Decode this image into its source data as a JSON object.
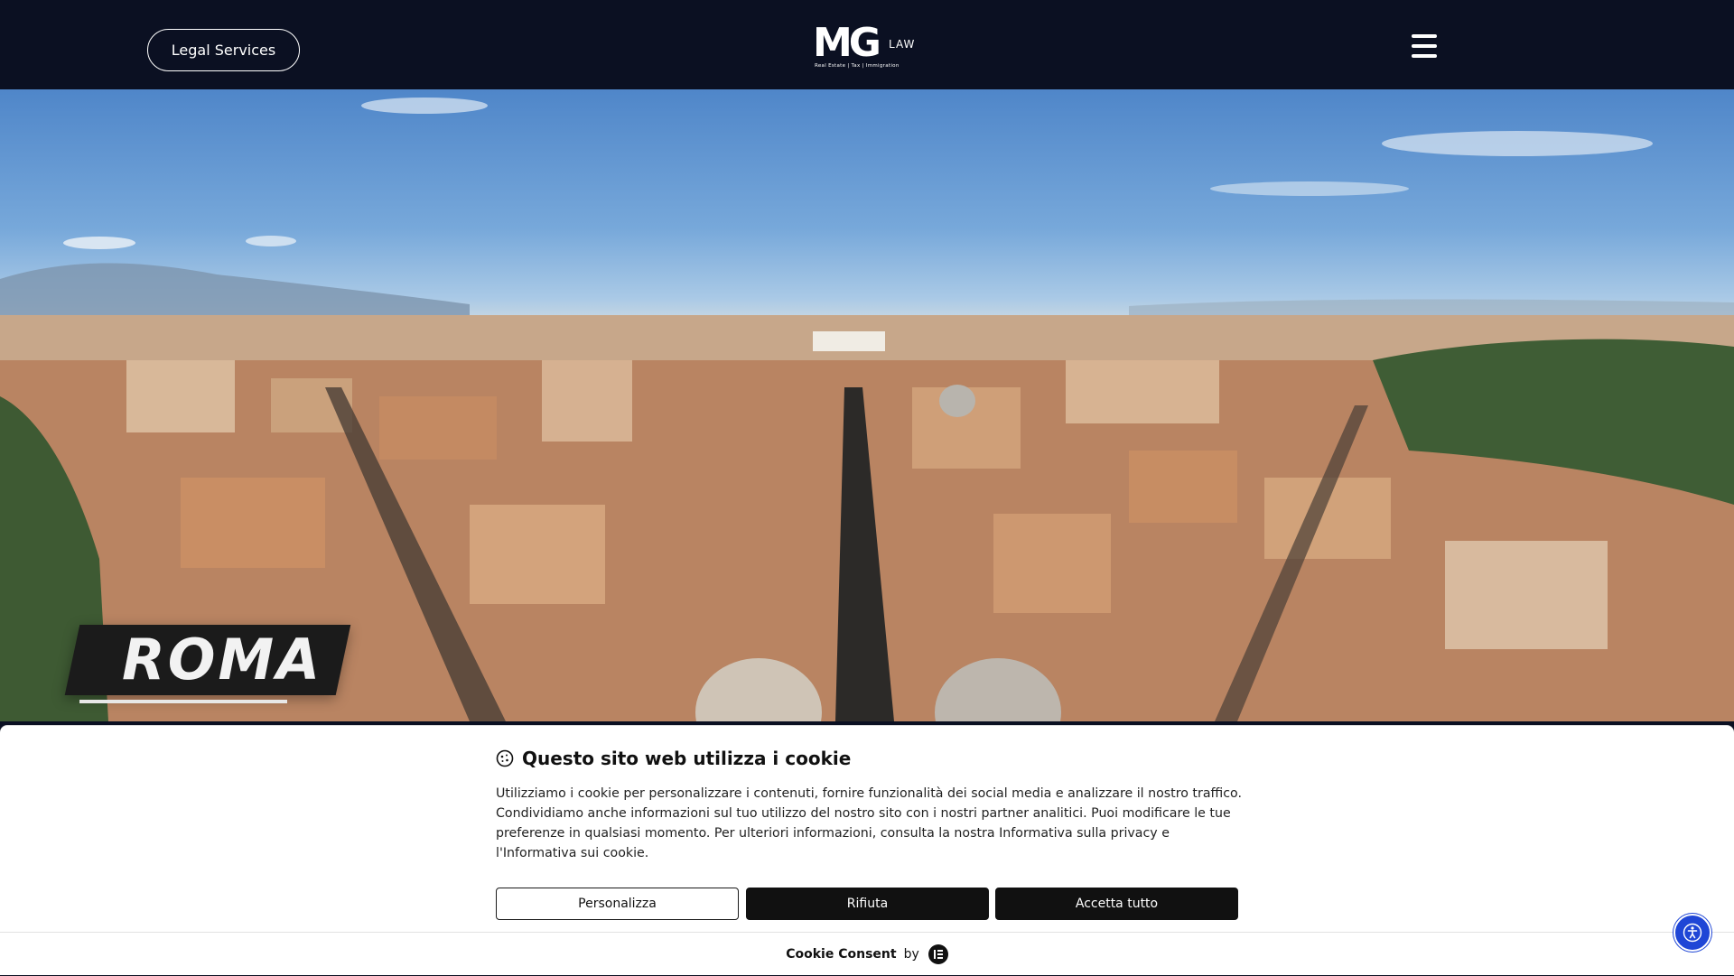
{
  "header": {
    "legal_services_label": "Legal Services",
    "logo_primary": "MG",
    "logo_secondary": "LAW",
    "logo_tagline": "Real Estate | Tax | Immigration",
    "menu_icon": "hamburger-menu-icon"
  },
  "hero": {
    "city_label": "ROMA"
  },
  "cookie_banner": {
    "icon": "cookie-icon",
    "title": "Questo sito web utilizza i cookie",
    "body": "Utilizziamo i cookie per personalizzare i contenuti, fornire funzionalità dei social media e analizzare il nostro traffico. Condividiamo anche informazioni sul tuo utilizzo del nostro sito con i nostri partner analitici. Puoi modificare le tue preferenze in qualsiasi momento. Per ulteriori informazioni, consulta la nostra Informativa sulla privacy e l'Informativa sui cookie.",
    "customize_label": "Personalizza",
    "reject_label": "Rifiuta",
    "accept_label": "Accetta tutto",
    "footer_brand": "Cookie Consent",
    "footer_by": "by"
  },
  "accessibility": {
    "icon": "accessibility-icon"
  },
  "colors": {
    "header_bg": "#0b1022",
    "button_dark": "#111111",
    "accessibility_blue": "#1f46d6"
  }
}
